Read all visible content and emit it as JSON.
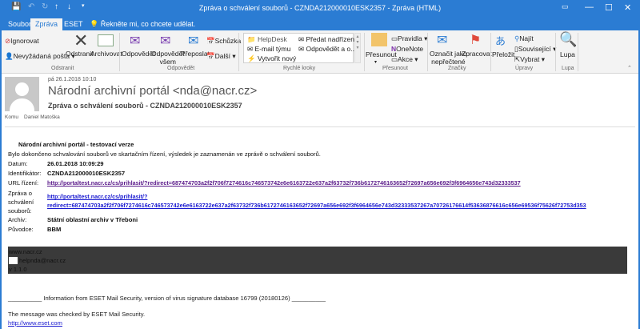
{
  "window": {
    "title": "Zpráva o schválení souborů - CZNDA212000010ESK2357  -  Zpráva (HTML)"
  },
  "tabs": [
    "Soubor",
    "Zpráva",
    "ESET"
  ],
  "tell_me": "Řekněte mi, co chcete udělat.",
  "ribbon": {
    "odstranit": {
      "ignore": "Ignorovat",
      "junk": "Nevyžádaná pošta",
      "delete": "Odstranit",
      "archive": "Archivovat",
      "label": "Odstranit"
    },
    "odpovedet": {
      "reply": "Odpovědět",
      "reply_all_1": "Odpovědět",
      "reply_all_2": "všem",
      "forward": "Přeposlat",
      "meeting": "Schůzka",
      "more": "Další",
      "label": "Odpovědět"
    },
    "quick": {
      "items": [
        "HelpDesk",
        "E-mail týmu",
        "Vytvořit nový",
        "Předat nadřízen...",
        "Odpovědět a o..."
      ],
      "label": "Rychlé kroky"
    },
    "presunout": {
      "move": "Přesunout",
      "rules": "Pravidla",
      "onenote": "OneNote",
      "actions": "Akce",
      "label": "Přesunout"
    },
    "znacky": {
      "unread_1": "Označit jako",
      "unread_2": "nepřečtené",
      "followup": "Zpracovat",
      "label": "Značky"
    },
    "upravy": {
      "translate": "Přeložit",
      "find": "Najít",
      "related": "Související",
      "select": "Vybrat",
      "label": "Úpravy"
    },
    "lupa": {
      "zoom": "Lupa",
      "label": "Lupa"
    }
  },
  "message": {
    "date": "pá 26.1.2018 10:10",
    "from": "Národní archivní portál <nda@nacr.cz>",
    "subject": "Zpráva o schválení souborů - CZNDA212000010ESK2357",
    "to_label": "Komu",
    "to": "Daniel Matoška"
  },
  "body": {
    "heading": "Národní archivní portál - testovací verze",
    "intro": "Bylo dokončeno schvalování souborů ve skartačním řízení, výsledek je zaznamenán ve zprávě o schválení souborů.",
    "fields": {
      "date_label": "Datum:",
      "date": "26.01.2018 10:09:29",
      "id_label": "Identifikátor:",
      "id": "CZNDA212000010ESK2357",
      "url_label": "URL řízení:",
      "url": "http://portaltest.nacr.cz/cs/prihlasit/?redirect=687474703a2f2f706f7274616c746573742e6e6163722e637a2f63732f736b6172746163652f72697a656e692f3f6964656e743d32333537",
      "report_label_1": "Zpráva o",
      "report_label_2": "schválení",
      "report_label_3": "souborů:",
      "report_url_1": "http://portaltest.nacr.cz/cs/prihlasit/?",
      "report_url_2": "redirect=687474703a2f2f706f7274616c746573742e6e6163722e637a2f63732f736b6172746163652f72697a656e692f3f6964656e743d32333537267a70726176614f53636876616c656e69536f75626f72753d353",
      "archive_label": "Archiv:",
      "archive": "Státní oblastní archiv v Třeboni",
      "origin_label": "Původce:",
      "origin": "BBM"
    },
    "footer_dark": [
      "www.nacr.cz",
      "helpnda@nacr.cz",
      "v 1.1.0"
    ],
    "eset_info": "__________ Information from ESET Mail Security, version of virus signature database 16799 (20180126) __________",
    "eset_checked": "The message was checked by ESET Mail Security.",
    "eset_link": "http://www.eset.com"
  }
}
